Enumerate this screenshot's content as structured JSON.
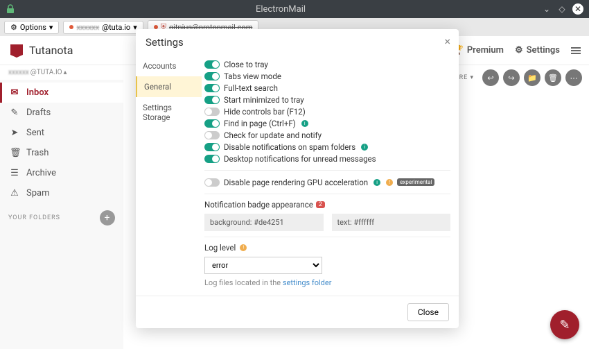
{
  "window": {
    "title": "ElectronMail"
  },
  "tabbar": {
    "options": "Options",
    "tab1": "@tuta.io",
    "tab2": "gitpius@protonmail.com"
  },
  "brand": "Tutanota",
  "account": {
    "domain": "@TUTA.IO"
  },
  "header": {
    "premium": "Premium",
    "settings": "Settings",
    "showmore": "SHOW MORE"
  },
  "folders": [
    {
      "icon": "✉",
      "label": "Inbox",
      "active": true
    },
    {
      "icon": "✎",
      "label": "Drafts"
    },
    {
      "icon": "➤",
      "label": "Sent"
    },
    {
      "icon": "🗑",
      "label": "Trash"
    },
    {
      "icon": "☰",
      "label": "Archive"
    },
    {
      "icon": "⚠",
      "label": "Spam"
    }
  ],
  "yourFolders": "YOUR FOLDERS",
  "modal": {
    "title": "Settings",
    "nav": [
      "Accounts",
      "General",
      "Settings Storage"
    ],
    "navActive": 1,
    "toggles": [
      {
        "on": true,
        "label": "Close to tray"
      },
      {
        "on": true,
        "label": "Tabs view mode"
      },
      {
        "on": true,
        "label": "Full-text search"
      },
      {
        "on": true,
        "label": "Start minimized to tray"
      },
      {
        "on": false,
        "label": "Hide controls bar (F12)"
      },
      {
        "on": true,
        "label": "Find in page (Ctrl+F)",
        "info": true
      },
      {
        "on": false,
        "label": "Check for update and notify"
      },
      {
        "on": true,
        "label": "Disable notifications on spam folders",
        "info": true
      },
      {
        "on": true,
        "label": "Desktop notifications for unread messages"
      }
    ],
    "gpuToggle": {
      "on": false,
      "label": "Disable page rendering GPU acceleration",
      "badge": "experimental"
    },
    "notifLabel": "Notification badge appearance",
    "notifBadge": "2",
    "bgInput": "background: #de4251",
    "textInput": "text: #ffffff",
    "logLevelLabel": "Log level",
    "logLevelValue": "error",
    "logNote": "Log files located in the ",
    "logLink": "settings folder",
    "closeBtn": "Close"
  }
}
